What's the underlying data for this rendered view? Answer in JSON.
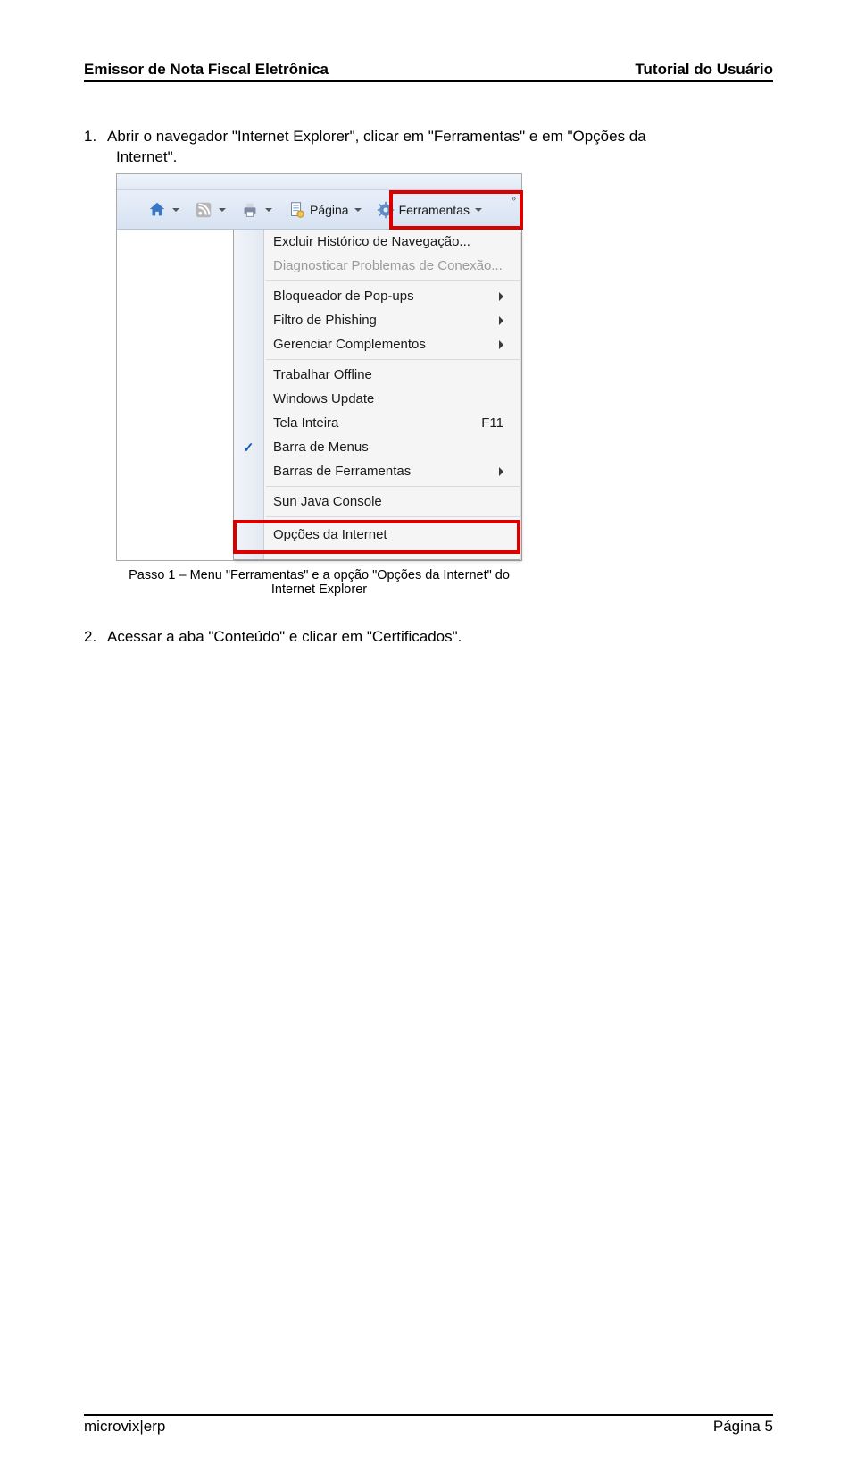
{
  "header": {
    "left": "Emissor de Nota Fiscal Eletrônica",
    "right": "Tutorial do Usuário"
  },
  "step1": {
    "num": "1.",
    "text_a": "Abrir o navegador \"Internet Explorer\", clicar em \"Ferramentas\" e em \"Opções da",
    "text_b": "Internet\"."
  },
  "toolbar": {
    "pagina_label": "Página",
    "ferramentas_label": "Ferramentas"
  },
  "menu": {
    "excluir": "Excluir Histórico de Navegação...",
    "diag": "Diagnosticar Problemas de Conexão...",
    "popup": "Bloqueador de Pop-ups",
    "phishing": "Filtro de Phishing",
    "complementos": "Gerenciar Complementos",
    "offline": "Trabalhar Offline",
    "update": "Windows Update",
    "tela_inteira": "Tela Inteira",
    "tela_short": "F11",
    "barra_menus": "Barra de Menus",
    "barras_ferr": "Barras de Ferramentas",
    "java": "Sun Java Console",
    "opcoes_internet": "Opções da Internet"
  },
  "caption1": "Passo 1 – Menu \"Ferramentas\" e a opção \"Opções da Internet\" do Internet Explorer",
  "step2": {
    "num": "2.",
    "text": "Acessar a aba \"Conteúdo\" e clicar em \"Certificados\"."
  },
  "footer": {
    "left": "microvix|erp",
    "right": "Página 5"
  }
}
